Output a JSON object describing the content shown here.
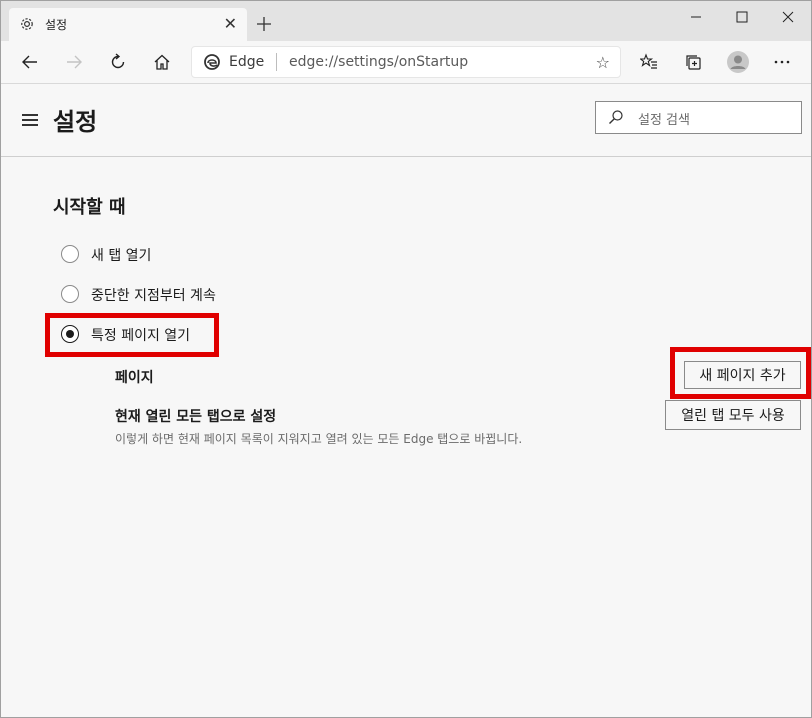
{
  "tab": {
    "title": "설정",
    "icon": "gear-icon"
  },
  "toolbar": {
    "site_label": "Edge",
    "url": "edge://settings/onStartup"
  },
  "header": {
    "title": "설정",
    "search_placeholder": "설정 검색"
  },
  "startup": {
    "section_title": "시작할 때",
    "options": [
      {
        "label": "새 탭 열기",
        "selected": false
      },
      {
        "label": "중단한 지점부터 계속",
        "selected": false
      },
      {
        "label": "특정 페이지 열기",
        "selected": true
      }
    ],
    "pages_label": "페이지",
    "add_page_button": "새 페이지 추가",
    "use_current_title": "현재 열린 모든 탭으로 설정",
    "use_current_desc": "이렇게 하면 현재 페이지 목록이 지워지고 열려 있는 모든 Edge 탭으로 바뀝니다.",
    "use_all_tabs_button": "열린 탭 모두 사용"
  },
  "colors": {
    "highlight": "#e00000",
    "background": "#f7f7f7"
  }
}
